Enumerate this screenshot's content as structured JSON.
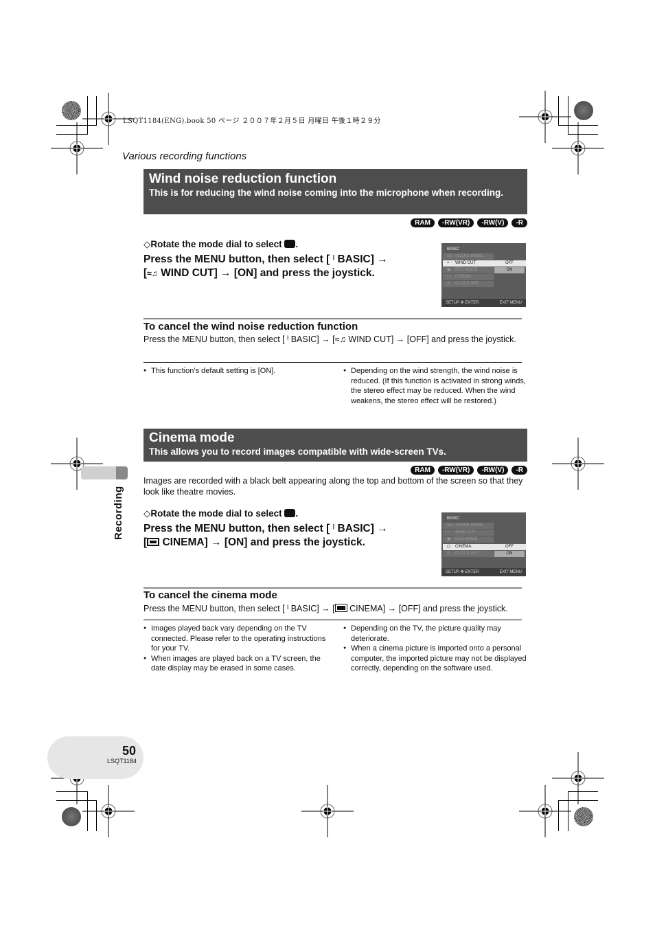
{
  "print_header": "LSQT1184(ENG).book  50 ページ  ２００７年２月５日  月曜日  午後１時２９分",
  "running_title": "Various recording functions",
  "side_tab": "Recording",
  "footer": {
    "page_number": "50",
    "doc_code": "LSQT1184"
  },
  "disc_badges": [
    "RAM",
    "-RW(VR)",
    "-RW(V)",
    "-R"
  ],
  "wind": {
    "title": "Wind noise reduction function",
    "subtitle": "This is for reducing the wind noise coming into the microphone when recording.",
    "step_dial": "Rotate the mode dial to select",
    "step_menu_line1": "Press the MENU button, then select [ \u0002 BASIC] →",
    "step_menu_l1a": "Press the MENU button, then select [",
    "step_menu_l1b": "BASIC] →",
    "step_menu_l2a": "[",
    "step_menu_l2b": "WIND CUT] → [ON] and press the joystick.",
    "cancel_title": "To cancel the wind noise reduction function",
    "cancel_a": "Press the MENU button, then select [",
    "cancel_b": "BASIC] → [",
    "cancel_c": "WIND CUT] → [OFF] and press the joystick.",
    "notes_left": [
      "This function’s default setting is [ON]."
    ],
    "notes_right": [
      "Depending on the wind strength, the wind noise is reduced. (If this function is activated in strong winds, the stereo effect may be reduced. When the wind weakens, the stereo effect will be restored.)"
    ],
    "screen": {
      "header": "BASIC",
      "items": [
        "SCENE MODE",
        "WIND CUT",
        "REC MODE",
        "CINEMA",
        "CLOCK SET"
      ],
      "selected": "WIND CUT",
      "options": [
        "OFF",
        "ON"
      ],
      "footer_left": "SETUP ✥ ENTER",
      "footer_right": "EXIT MENU"
    }
  },
  "cinema": {
    "title": "Cinema mode",
    "subtitle": "This allows you to record images compatible with wide-screen TVs.",
    "intro": "Images are recorded with a black belt appearing along the top and bottom of the screen so that they look like theatre movies.",
    "step_dial": "Rotate the mode dial to select",
    "step_menu_l1a": "Press the MENU button, then select [",
    "step_menu_l1b": "BASIC] →",
    "step_menu_l2a": "[",
    "step_menu_l2b": "CINEMA] → [ON] and press the joystick.",
    "cancel_title": "To cancel the cinema mode",
    "cancel_a": "Press the MENU button, then select [",
    "cancel_b": "BASIC] → [",
    "cancel_c": "CINEMA] → [OFF] and press the joystick.",
    "notes_left": [
      "Images played back vary depending on the TV connected. Please refer to the operating instructions for your TV.",
      "When images are played back on a TV screen, the date display may be erased in some cases."
    ],
    "notes_right": [
      "Depending on the TV, the picture quality may deteriorate.",
      "When a cinema picture is imported onto a personal computer, the imported picture may not be displayed correctly, depending on the software used."
    ],
    "screen": {
      "header": "BASIC",
      "items": [
        "SCENE MODE",
        "WIND CUT",
        "REC MODE",
        "CINEMA",
        "CLOCK SET"
      ],
      "selected": "CINEMA",
      "options": [
        "OFF",
        "ON"
      ],
      "footer_left": "SETUP ✥ ENTER",
      "footer_right": "EXIT MENU"
    }
  }
}
